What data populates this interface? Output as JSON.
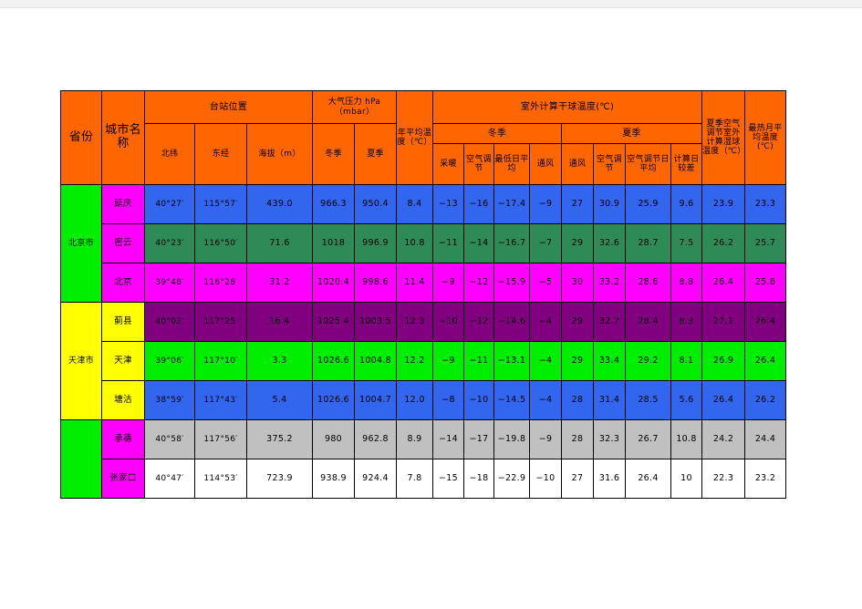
{
  "table": {
    "headers": {
      "province": "省份",
      "city": "城市名称",
      "station_group": "台站位置",
      "latitude": "北纬",
      "longitude": "东经",
      "altitude": "海拔（m）",
      "pressure_group": "大气压力 hPa（mbar）",
      "pressure_winter": "冬季",
      "pressure_summer": "夏季",
      "annual_mean_temp": "年平均温度（℃）",
      "outdoor_drybulb_group": "室外计算干球温度(℃)",
      "winter_group": "冬季",
      "summer_group": "夏季",
      "w_heating": "采暖",
      "w_aircon": "空气调节",
      "w_min_daily_mean": "最低日平均",
      "w_ventilation": "通风",
      "s_ventilation": "通风",
      "s_aircon": "空气调节",
      "s_aircon_daily_mean": "空气调节日平均",
      "s_daily_range": "计算日较差",
      "summer_wetbulb": "夏季空气调节室外计算湿球温度（℃）",
      "hottest_month_mean": "最热月平均温度(℃)"
    },
    "provinces": [
      {
        "name": "北京市",
        "fill": "c-green",
        "city_fill": "c-mag",
        "rows": 3
      },
      {
        "name": "天津市",
        "fill": "c-yellow",
        "city_fill": "c-yellow",
        "rows": 3
      },
      {
        "name": "",
        "fill": "c-green",
        "city_fill": "c-mag",
        "rows": 2
      }
    ],
    "rows": [
      {
        "fill": "c-blue",
        "city": "延庆",
        "latitude": "40°27′",
        "longitude": "115°57′",
        "altitude": "439.0",
        "pressure_winter": "966.3",
        "pressure_summer": "950.4",
        "annual_mean_temp": "8.4",
        "w_heating": "−13",
        "w_aircon": "−16",
        "w_min_daily_mean": "−17.4",
        "w_ventilation": "−9",
        "s_ventilation": "27",
        "s_aircon": "30.9",
        "s_aircon_daily_mean": "25.9",
        "s_daily_range": "9.6",
        "summer_wetbulb": "23.9",
        "hottest_month_mean": "23.3"
      },
      {
        "fill": "c-sea",
        "city": "密云",
        "latitude": "40°23′",
        "longitude": "116°50′",
        "altitude": "71.6",
        "pressure_winter": "1018",
        "pressure_summer": "996.9",
        "annual_mean_temp": "10.8",
        "w_heating": "−11",
        "w_aircon": "−14",
        "w_min_daily_mean": "−16.7",
        "w_ventilation": "−7",
        "s_ventilation": "29",
        "s_aircon": "32.6",
        "s_aircon_daily_mean": "28.7",
        "s_daily_range": "7.5",
        "summer_wetbulb": "26.2",
        "hottest_month_mean": "25.7"
      },
      {
        "fill": "c-mag",
        "city": "北京",
        "latitude": "39°48′",
        "longitude": "116°28′",
        "altitude": "31.2",
        "pressure_winter": "1020.4",
        "pressure_summer": "998.6",
        "annual_mean_temp": "11.4",
        "w_heating": "−9",
        "w_aircon": "−12",
        "w_min_daily_mean": "−15.9",
        "w_ventilation": "−5",
        "s_ventilation": "30",
        "s_aircon": "33.2",
        "s_aircon_daily_mean": "28.6",
        "s_daily_range": "8.8",
        "summer_wetbulb": "26.4",
        "hottest_month_mean": "25.8"
      },
      {
        "fill": "c-purple",
        "city": "蓟县",
        "latitude": "40°02′",
        "longitude": "117°25′",
        "altitude": "16.4",
        "pressure_winter": "1025.4",
        "pressure_summer": "1003.5",
        "annual_mean_temp": "12.3",
        "w_heating": "−10",
        "w_aircon": "−12",
        "w_min_daily_mean": "−14.6",
        "w_ventilation": "−4",
        "s_ventilation": "29",
        "s_aircon": "32.7",
        "s_aircon_daily_mean": "28.4",
        "s_daily_range": "8.3",
        "summer_wetbulb": "27.1",
        "hottest_month_mean": "26.4"
      },
      {
        "fill": "c-green",
        "city": "天津",
        "latitude": "39°06′",
        "longitude": "117°10′",
        "altitude": "3.3",
        "pressure_winter": "1026.6",
        "pressure_summer": "1004.8",
        "annual_mean_temp": "12.2",
        "w_heating": "−9",
        "w_aircon": "−11",
        "w_min_daily_mean": "−13.1",
        "w_ventilation": "−4",
        "s_ventilation": "29",
        "s_aircon": "33.4",
        "s_aircon_daily_mean": "29.2",
        "s_daily_range": "8.1",
        "summer_wetbulb": "26.9",
        "hottest_month_mean": "26.4"
      },
      {
        "fill": "c-blue",
        "city": "塘沽",
        "latitude": "38°59′",
        "longitude": "117°43′",
        "altitude": "5.4",
        "pressure_winter": "1026.6",
        "pressure_summer": "1004.7",
        "annual_mean_temp": "12.0",
        "w_heating": "−8",
        "w_aircon": "−10",
        "w_min_daily_mean": "−14.5",
        "w_ventilation": "−4",
        "s_ventilation": "28",
        "s_aircon": "31.4",
        "s_aircon_daily_mean": "28.5",
        "s_daily_range": "5.6",
        "summer_wetbulb": "26.4",
        "hottest_month_mean": "26.2"
      },
      {
        "fill": "c-gray",
        "city": "承德",
        "latitude": "40°58′",
        "longitude": "117°56′",
        "altitude": "375.2",
        "pressure_winter": "980",
        "pressure_summer": "962.8",
        "annual_mean_temp": "8.9",
        "w_heating": "−14",
        "w_aircon": "−17",
        "w_min_daily_mean": "−19.8",
        "w_ventilation": "−9",
        "s_ventilation": "28",
        "s_aircon": "32.3",
        "s_aircon_daily_mean": "26.7",
        "s_daily_range": "10.8",
        "summer_wetbulb": "24.2",
        "hottest_month_mean": "24.4"
      },
      {
        "fill": "c-white",
        "city": "张家口",
        "latitude": "40°47′",
        "longitude": "114°53′",
        "altitude": "723.9",
        "pressure_winter": "938.9",
        "pressure_summer": "924.4",
        "annual_mean_temp": "7.8",
        "w_heating": "−15",
        "w_aircon": "−18",
        "w_min_daily_mean": "−22.9",
        "w_ventilation": "−10",
        "s_ventilation": "27",
        "s_aircon": "31.6",
        "s_aircon_daily_mean": "26.4",
        "s_daily_range": "10",
        "summer_wetbulb": "22.3",
        "hottest_month_mean": "23.2"
      }
    ]
  }
}
